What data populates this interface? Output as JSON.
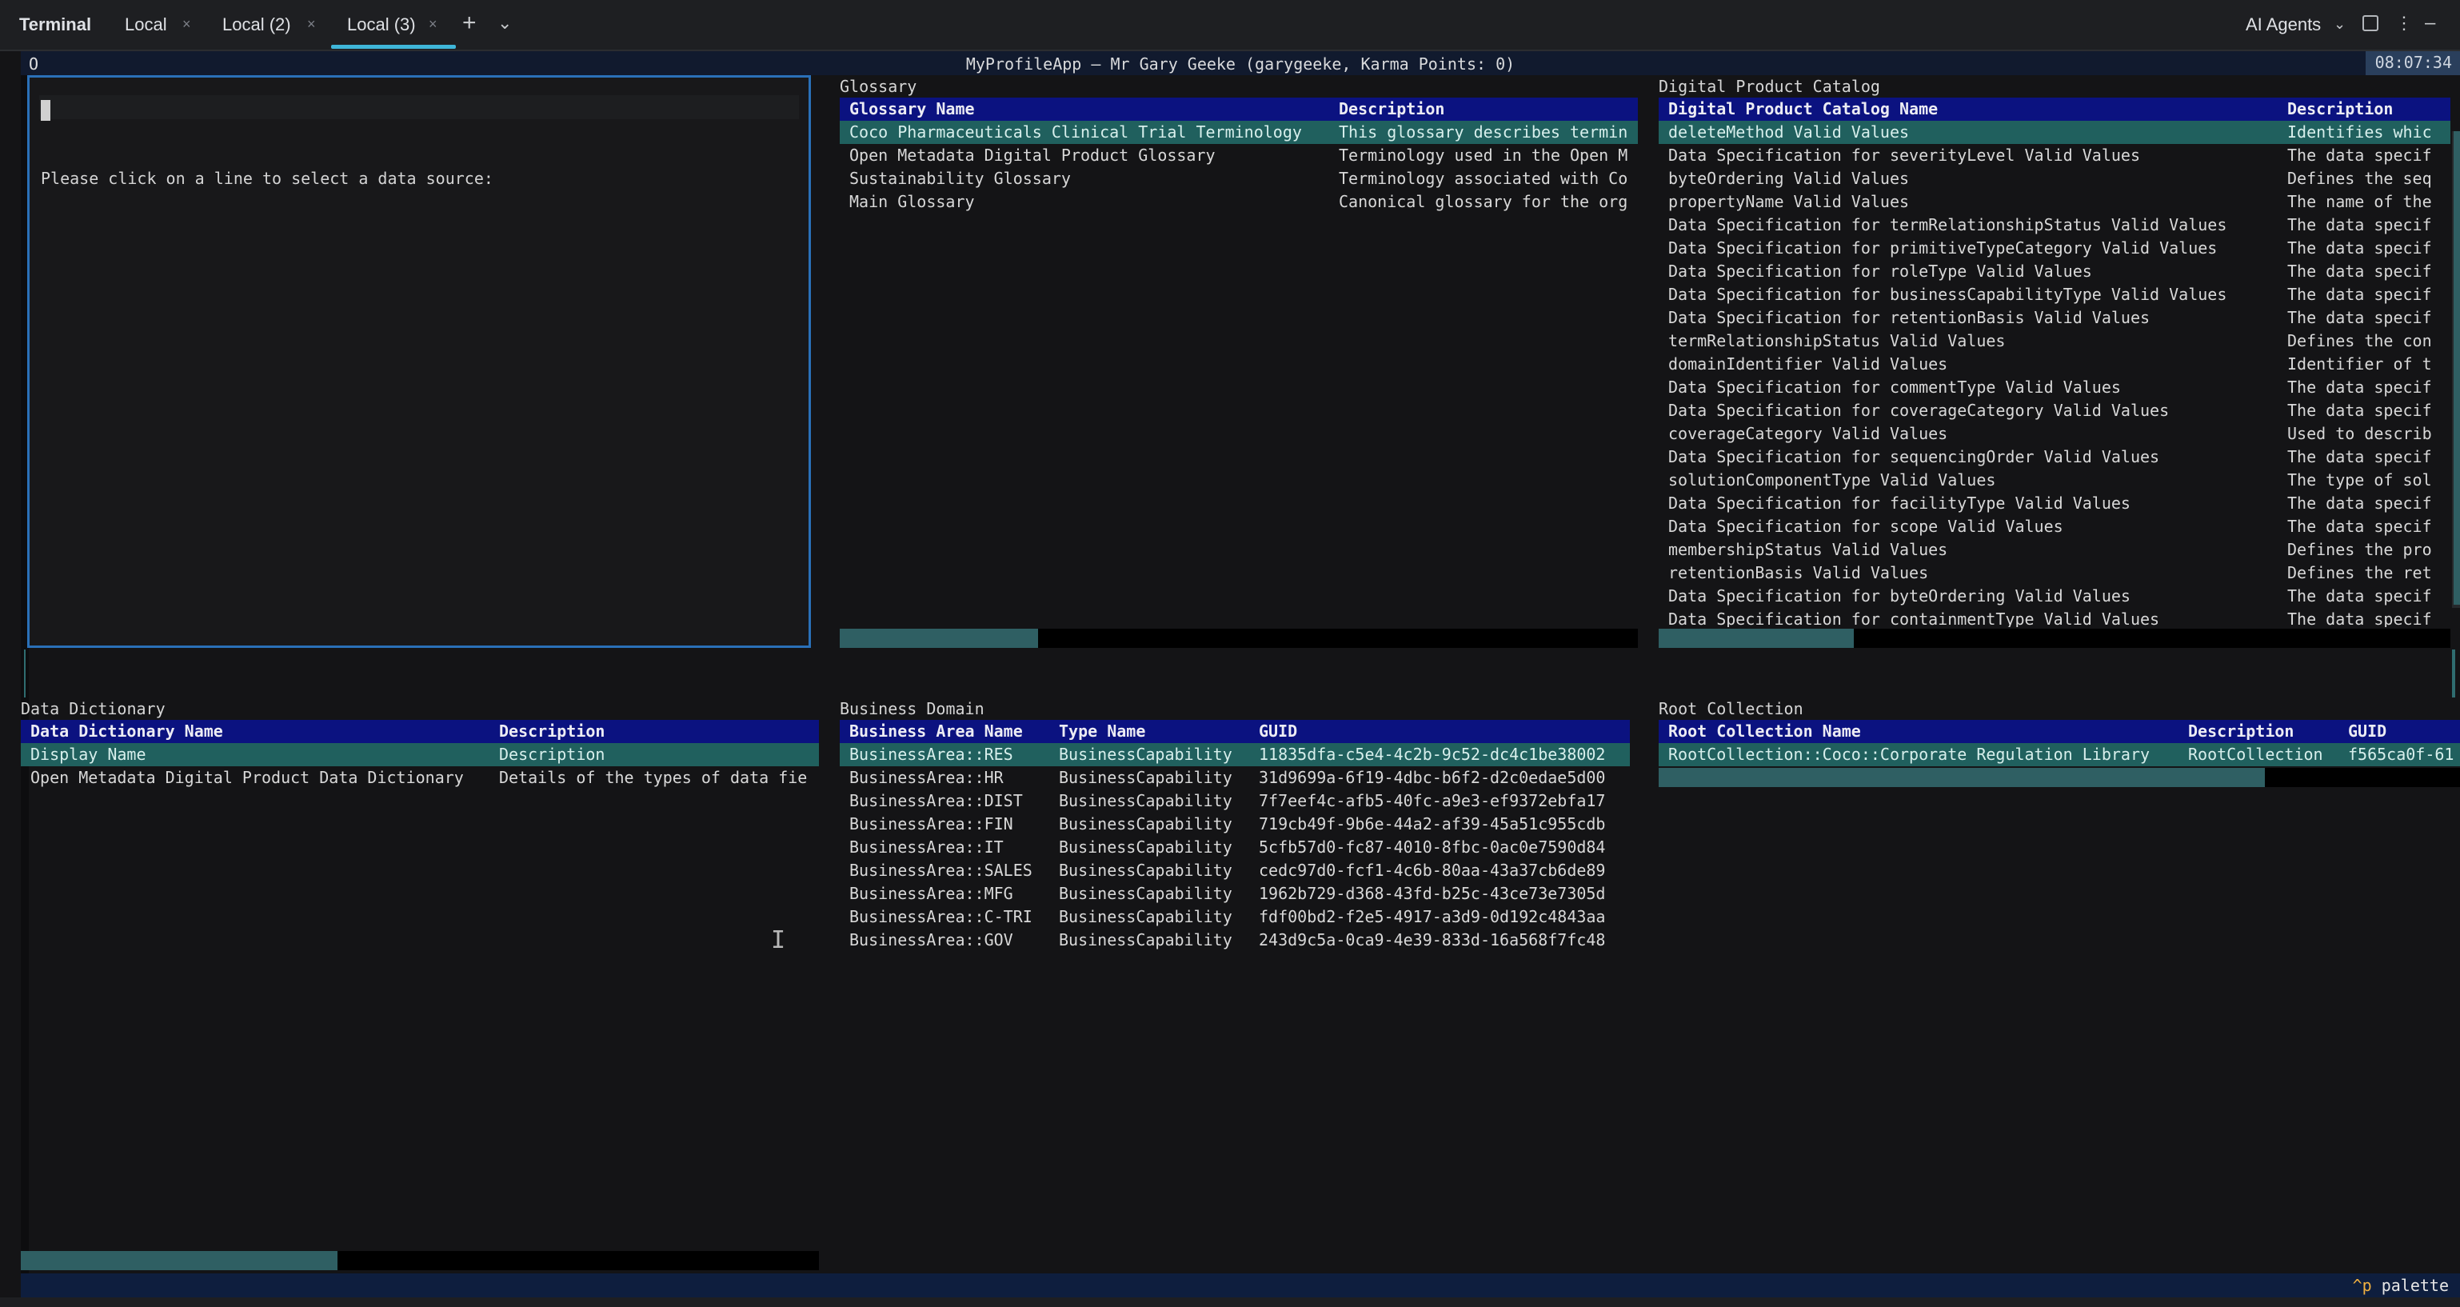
{
  "ide": {
    "tabs": [
      {
        "label": "Terminal"
      },
      {
        "label": "Local"
      },
      {
        "label": "Local (2)"
      },
      {
        "label": "Local (3)"
      }
    ],
    "close_glyph": "×",
    "new_tab_glyph": "+",
    "dropdown_glyph": "⌄",
    "ai_agents_label": "AI Agents"
  },
  "app": {
    "icon_glyph": "O",
    "title": "MyProfileApp — Mr Gary Geeke (garygeeke, Karma Points: 0)",
    "clock": "08:07:34"
  },
  "selection": {
    "prompt": "Please click on a line to select a data source:"
  },
  "glossary": {
    "title": "Glossary",
    "columns": [
      "Glossary Name",
      "Description"
    ],
    "rows": [
      [
        "Coco Pharmaceuticals Clinical Trial Terminology",
        "This glossary describes termin"
      ],
      [
        "Open Metadata Digital Product Glossary",
        "Terminology used in the Open M"
      ],
      [
        "Sustainability Glossary",
        "Terminology associated with Co"
      ],
      [
        "Main Glossary",
        "Canonical glossary for the org"
      ]
    ]
  },
  "catalog": {
    "title": "Digital Product Catalog",
    "columns": [
      "Digital Product Catalog Name",
      "Description"
    ],
    "rows": [
      [
        "deleteMethod Valid Values",
        "Identifies whic"
      ],
      [
        "Data Specification for severityLevel Valid Values",
        "The data specif"
      ],
      [
        "byteOrdering Valid Values",
        "Defines the seq"
      ],
      [
        "propertyName Valid Values",
        "The name of the"
      ],
      [
        "Data Specification for termRelationshipStatus Valid Values",
        "The data specif"
      ],
      [
        "Data Specification for primitiveTypeCategory Valid Values",
        "The data specif"
      ],
      [
        "Data Specification for roleType Valid Values",
        "The data specif"
      ],
      [
        "Data Specification for businessCapabilityType Valid Values",
        "The data specif"
      ],
      [
        "Data Specification for retentionBasis Valid Values",
        "The data specif"
      ],
      [
        "termRelationshipStatus Valid Values",
        "Defines the con"
      ],
      [
        "domainIdentifier Valid Values",
        "Identifier of t"
      ],
      [
        "Data Specification for commentType Valid Values",
        "The data specif"
      ],
      [
        "Data Specification for coverageCategory Valid Values",
        "The data specif"
      ],
      [
        "coverageCategory Valid Values",
        "Used to describ"
      ],
      [
        "Data Specification for sequencingOrder Valid Values",
        "The data specif"
      ],
      [
        "solutionComponentType Valid Values",
        "The type of sol"
      ],
      [
        "Data Specification for facilityType Valid Values",
        "The data specif"
      ],
      [
        "Data Specification for scope Valid Values",
        "The data specif"
      ],
      [
        "membershipStatus Valid Values",
        "Defines the pro"
      ],
      [
        "retentionBasis Valid Values",
        "Defines the ret"
      ],
      [
        "Data Specification for byteOrdering Valid Values",
        "The data specif"
      ],
      [
        "Data Specification for containmentType Valid Values",
        "The data specif"
      ]
    ]
  },
  "dictionary": {
    "title": "Data Dictionary",
    "columns": [
      "Data Dictionary Name",
      "Description"
    ],
    "rows": [
      [
        "Display Name",
        "Description"
      ],
      [
        "Open Metadata Digital Product Data Dictionary",
        "Details of the types of data fie"
      ]
    ]
  },
  "business": {
    "title": "Business Domain",
    "columns": [
      "Business Area Name",
      "Type Name",
      "GUID"
    ],
    "rows": [
      [
        "BusinessArea::RES",
        "BusinessCapability",
        "11835dfa-c5e4-4c2b-9c52-dc4c1be38002"
      ],
      [
        "BusinessArea::HR",
        "BusinessCapability",
        "31d9699a-6f19-4dbc-b6f2-d2c0edae5d00"
      ],
      [
        "BusinessArea::DIST",
        "BusinessCapability",
        "7f7eef4c-afb5-40fc-a9e3-ef9372ebfa17"
      ],
      [
        "BusinessArea::FIN",
        "BusinessCapability",
        "719cb49f-9b6e-44a2-af39-45a51c955cdb"
      ],
      [
        "BusinessArea::IT",
        "BusinessCapability",
        "5cfb57d0-fc87-4010-8fbc-0ac0e7590d84"
      ],
      [
        "BusinessArea::SALES",
        "BusinessCapability",
        "cedc97d0-fcf1-4c6b-80aa-43a37cb6de89"
      ],
      [
        "BusinessArea::MFG",
        "BusinessCapability",
        "1962b729-d368-43fd-b25c-43ce73e7305d"
      ],
      [
        "BusinessArea::C-TRI",
        "BusinessCapability",
        "fdf00bd2-f2e5-4917-a3d9-0d192c4843aa"
      ],
      [
        "BusinessArea::GOV",
        "BusinessCapability",
        "243d9c5a-0ca9-4e39-833d-16a568f7fc48"
      ]
    ]
  },
  "root": {
    "title": "Root Collection",
    "columns": [
      "Root Collection Name",
      "Description",
      "GUID"
    ],
    "rows": [
      [
        "RootCollection::Coco::Corporate Regulation Library",
        "RootCollection",
        "f565ca0f-61"
      ]
    ]
  },
  "footer": {
    "key": "^p",
    "action": "palette"
  }
}
